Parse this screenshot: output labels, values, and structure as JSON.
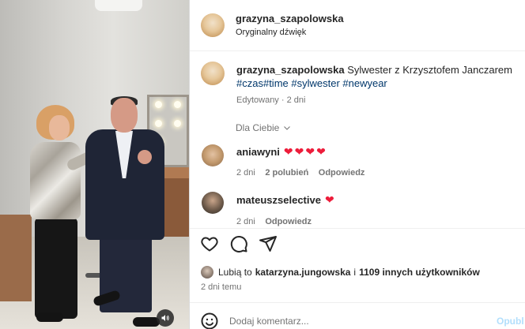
{
  "header": {
    "username": "grazyna_szapolowska",
    "audio": "Oryginalny dźwięk"
  },
  "post": {
    "username": "grazyna_szapolowska",
    "caption": "Sylwester z Krzysztofem Janczarem",
    "hashtags": "#czas#time #sylwester #newyear",
    "edited": "Edytowany",
    "dot": "·",
    "time": "2 dni",
    "filter": "Dla Ciebie"
  },
  "comments": [
    {
      "username": "aniawyni",
      "hearts": "❤❤❤❤",
      "time": "2 dni",
      "likes": "2 polubień",
      "reply": "Odpowiedz"
    },
    {
      "username": "mateuszselective",
      "hearts": "❤",
      "time": "2 dni",
      "reply": "Odpowiedz"
    }
  ],
  "likes_line": {
    "prefix": "Lubią to",
    "user": "katarzyna.jungowska",
    "conj": "i",
    "others": "1109 innych użytkowników"
  },
  "posted": "2 dni temu",
  "comment_box": {
    "placeholder": "Dodaj komentarz...",
    "publish": "Opubl"
  },
  "colors": {
    "accent": "#0095f6",
    "heart": "#ed1c3a",
    "hashtag": "#00376b"
  }
}
